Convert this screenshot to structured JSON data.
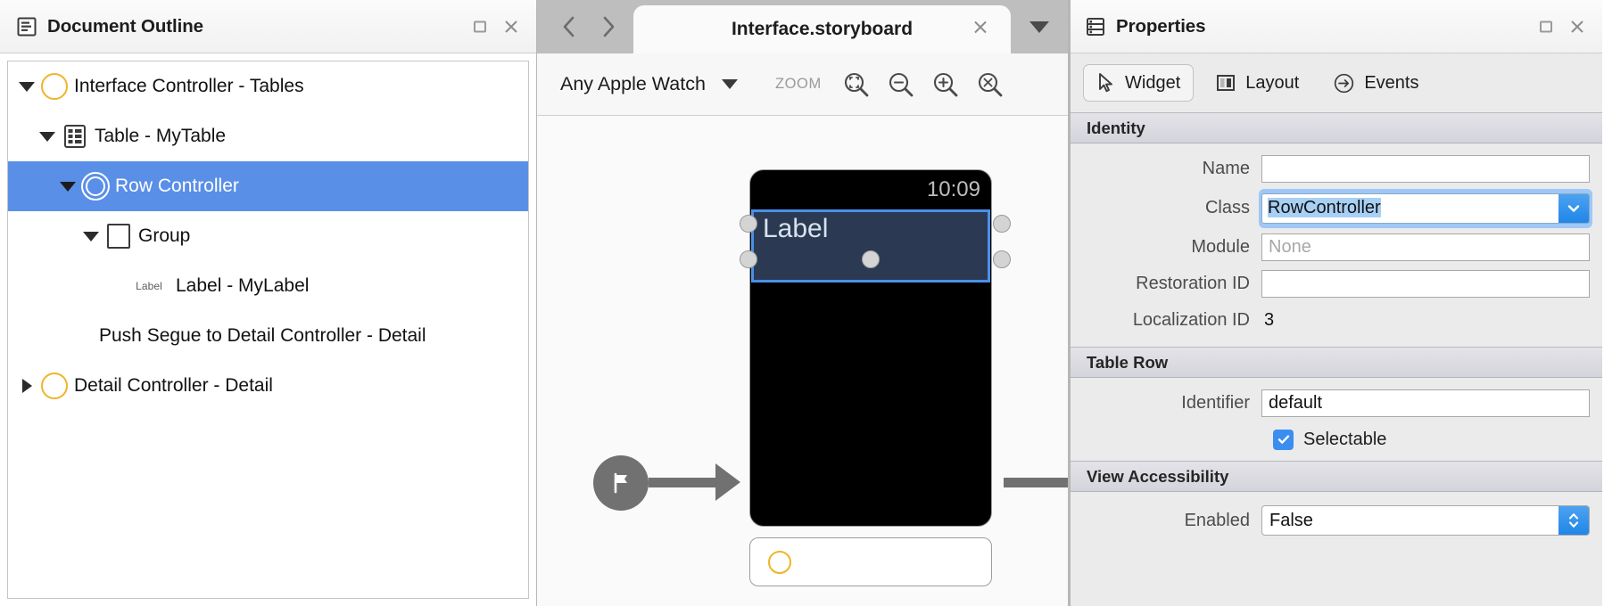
{
  "left_panel": {
    "title": "Document Outline",
    "header_icon": "document-outline-icon",
    "maximize_label": "maximize",
    "close_label": "close",
    "tree": [
      {
        "label": "Interface Controller - Tables",
        "icon": "yellow-ring-icon",
        "twisty": "down",
        "indent": 0,
        "selected": false
      },
      {
        "label": "Table - MyTable",
        "icon": "table-icon",
        "twisty": "down",
        "indent": 1,
        "selected": false
      },
      {
        "label": "Row Controller",
        "icon": "double-ring-icon",
        "twisty": "down",
        "indent": 2,
        "selected": true
      },
      {
        "label": "Group",
        "icon": "square-icon",
        "twisty": "down",
        "indent": 3,
        "selected": false
      },
      {
        "label": "Label - MyLabel",
        "icon": "label-text-icon",
        "icon_text": "Label",
        "twisty": "none",
        "indent": 4,
        "selected": false
      },
      {
        "label": "Push Segue to Detail Controller - Detail",
        "icon": "none",
        "twisty": "none",
        "indent": 4,
        "selected": false
      },
      {
        "label": "Detail Controller - Detail",
        "icon": "yellow-ring-icon",
        "twisty": "right",
        "indent": 0,
        "selected": false
      }
    ]
  },
  "center_panel": {
    "nav_back": "‹",
    "nav_forward": "›",
    "tab_title": "Interface.storyboard",
    "tab_close": "×",
    "tab_overflow": "tab-overflow-menu",
    "toolbar": {
      "device": "Any Apple Watch",
      "zoom_label": "ZOOM",
      "buttons": [
        {
          "name": "zoom-fit-icon",
          "title": "Zoom to Fit"
        },
        {
          "name": "zoom-out-icon",
          "title": "Zoom Out"
        },
        {
          "name": "zoom-in-icon",
          "title": "Zoom In"
        },
        {
          "name": "zoom-actual-size-icon",
          "title": "Actual Size"
        }
      ]
    },
    "canvas": {
      "entry_point_icon": "flag-icon",
      "watch_time": "10:09",
      "row_label": "Label",
      "bottom_card_icon": "yellow-ring-icon"
    }
  },
  "right_panel": {
    "title": "Properties",
    "header_icon": "properties-icon",
    "maximize_label": "maximize",
    "close_label": "close",
    "tabs": [
      {
        "label": "Widget",
        "icon": "cursor-icon",
        "active": true
      },
      {
        "label": "Layout",
        "icon": "layout-icon",
        "active": false
      },
      {
        "label": "Events",
        "icon": "arrow-circle-icon",
        "active": false
      }
    ],
    "sections": [
      {
        "title": "Identity",
        "fields": [
          {
            "type": "text",
            "label": "Name",
            "value": "",
            "placeholder": ""
          },
          {
            "type": "combo",
            "label": "Class",
            "value": "RowController",
            "focused": true
          },
          {
            "type": "text",
            "label": "Module",
            "value": "",
            "placeholder": "None"
          },
          {
            "type": "text",
            "label": "Restoration ID",
            "value": "",
            "placeholder": ""
          },
          {
            "type": "static",
            "label": "Localization ID",
            "value": "3"
          }
        ]
      },
      {
        "title": "Table Row",
        "fields": [
          {
            "type": "text",
            "label": "Identifier",
            "value": "default",
            "placeholder": ""
          },
          {
            "type": "checkbox",
            "label": "Selectable",
            "checked": true
          }
        ]
      },
      {
        "title": "View Accessibility",
        "fields": [
          {
            "type": "stepper",
            "label": "Enabled",
            "value": "False"
          }
        ]
      }
    ]
  },
  "colors": {
    "selection_blue": "#5a8fe8",
    "accent_blue": "#3b8ef0",
    "ring_yellow": "#f0b429",
    "canvas_bg": "#fafafa",
    "panel_bg": "#ebebeb"
  }
}
